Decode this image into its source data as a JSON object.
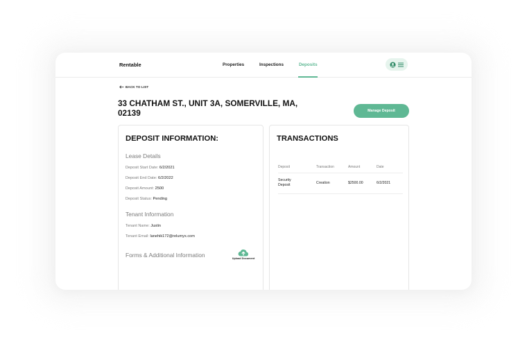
{
  "nav": {
    "brand": "Rentable",
    "links": [
      {
        "label": "Properties",
        "active": false
      },
      {
        "label": "Inspections",
        "active": false
      },
      {
        "label": "Deposits",
        "active": true
      }
    ],
    "icons": [
      "user-circle-icon",
      "menu-icon"
    ]
  },
  "back_link": "BACK TO LIST",
  "title": "33 CHATHAM ST., UNIT 3A, SOMERVILLE, MA, 02139",
  "manage_button": "Manage Deposit",
  "deposit_info": {
    "title": "DEPOSIT INFORMATION:",
    "lease_heading": "Lease Details",
    "lease_fields": [
      {
        "label": "Deposit Start Date:",
        "value": "6/2/2021"
      },
      {
        "label": "Deposit End Date:",
        "value": "6/2/2022"
      },
      {
        "label": "Deposit Amount:",
        "value": "2500"
      },
      {
        "label": "Deposit Status:",
        "value": "Pending"
      }
    ],
    "tenant_heading": "Tenant Information",
    "tenant_fields": [
      {
        "label": "Tenant Name:",
        "value": "Justin"
      },
      {
        "label": "Tenant Email:",
        "value": "lanehik172@relumyx.com"
      }
    ],
    "forms_heading": "Forms & Additional Information",
    "upload_label": "Upload Document"
  },
  "transactions": {
    "title": "TRANSACTIONS",
    "columns": [
      "Deposit",
      "Transaction",
      "Amount",
      "Date"
    ],
    "rows": [
      {
        "deposit": "Security Deposit",
        "transaction": "Creation",
        "amount": "$2500.00",
        "date": "6/2/2021"
      }
    ]
  },
  "colors": {
    "accent": "#5fb894",
    "accent_light": "#e6f4ed",
    "muted_text": "#7a7a7a"
  }
}
